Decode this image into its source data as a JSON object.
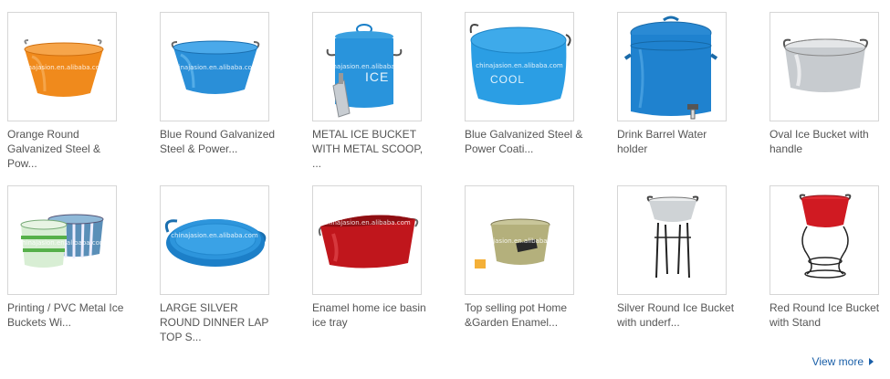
{
  "products": [
    {
      "title": "Orange Round Galvanized Steel & Pow...",
      "watermark": "chinajasion.en.alibaba.com",
      "icon": "orange-bucket-icon"
    },
    {
      "title": "Blue Round Galvanized Steel & Power...",
      "watermark": "chinajasion.en.alibaba.com",
      "icon": "blue-bucket-icon"
    },
    {
      "title": "METAL ICE BUCKET WITH METAL SCOOP, ...",
      "watermark": "chinajasion.en.alibaba.com",
      "label": "ICE",
      "icon": "ice-bucket-scoop-icon"
    },
    {
      "title": "Blue Galvanized Steel & Power Coati...",
      "watermark": "chinajasion.en.alibaba.com",
      "label": "COOL",
      "icon": "oval-cool-tub-icon"
    },
    {
      "title": "Drink Barrel Water holder",
      "icon": "water-barrel-icon"
    },
    {
      "title": "Oval Ice Bucket with handle",
      "icon": "oval-silver-bucket-icon"
    },
    {
      "title": "Printing / PVC Metal Ice Buckets Wi...",
      "watermark": "chinajasion.en.alibaba.com",
      "icon": "printed-buckets-icon"
    },
    {
      "title": "LARGE SILVER ROUND DINNER LAP TOP S...",
      "watermark": "chinajasion.en.alibaba.com",
      "icon": "blue-tray-icon"
    },
    {
      "title": "Enamel home ice basin ice tray",
      "watermark": "chinajasion.en.alibaba.com",
      "icon": "red-basin-icon"
    },
    {
      "title": "Top selling pot Home &Garden Enamel...",
      "watermark": "chinajasion.en.alibaba.com",
      "icon": "olive-pot-icon"
    },
    {
      "title": "Silver Round Ice Bucket with underf...",
      "icon": "silver-bucket-stand-icon"
    },
    {
      "title": "Red Round Ice Bucket with Stand",
      "icon": "red-bucket-stand-icon"
    }
  ],
  "view_more": {
    "label": "View more"
  }
}
